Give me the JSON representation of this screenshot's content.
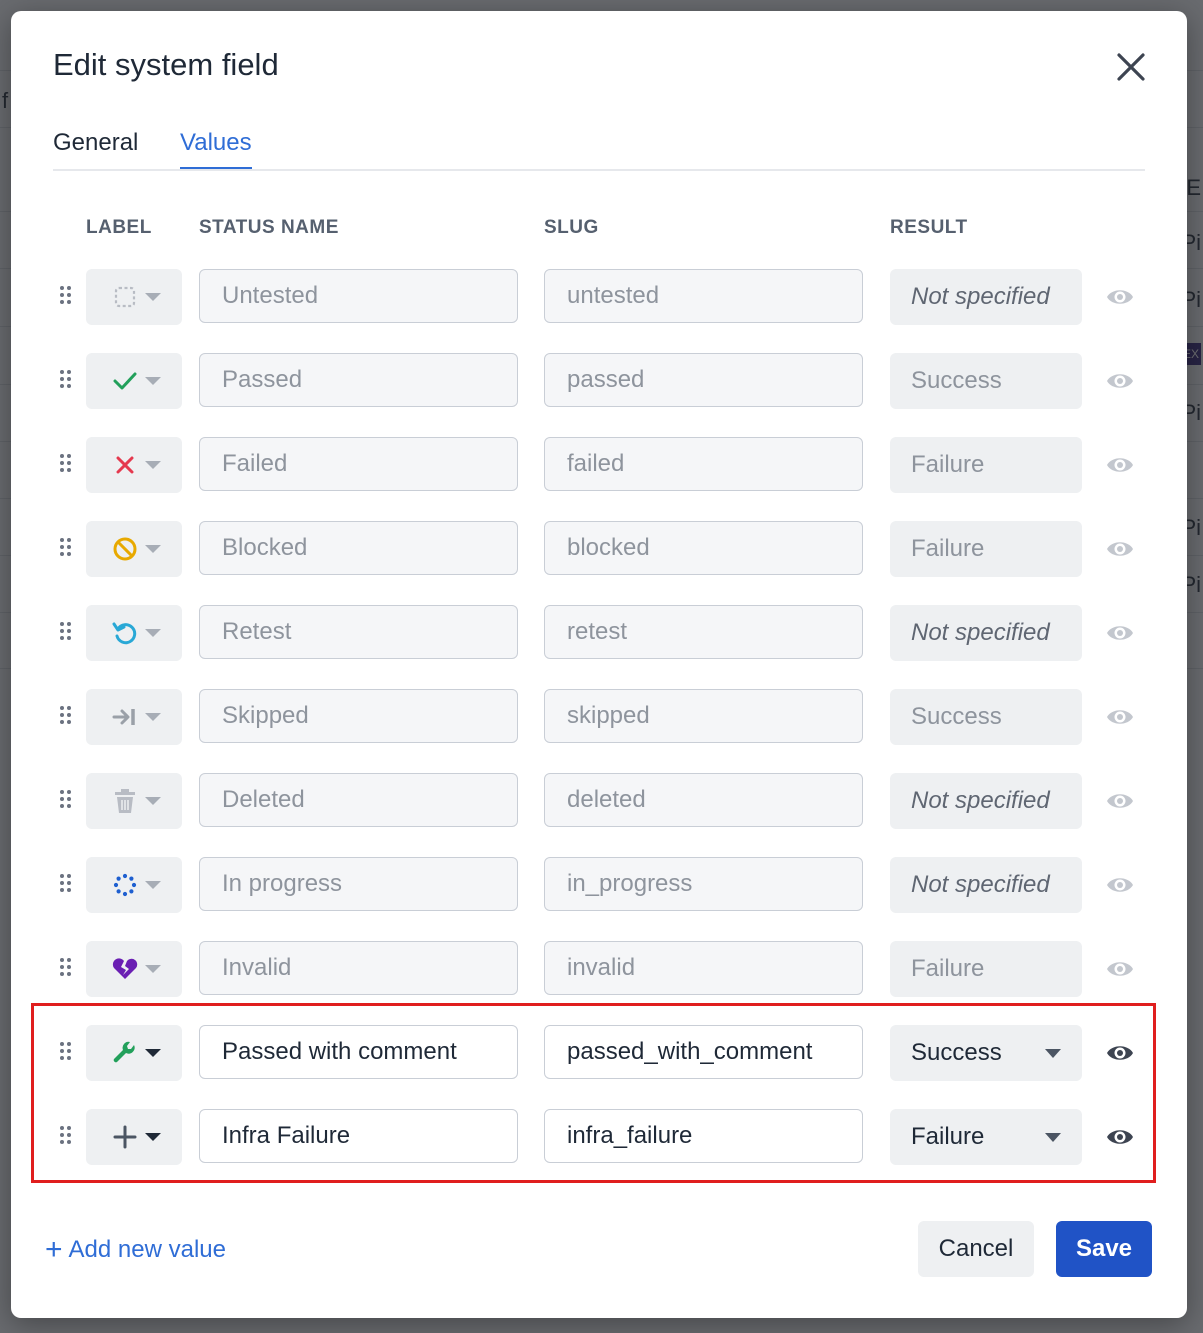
{
  "backdrop": {
    "fragments": [
      "f",
      "UE",
      "Pi",
      "Pi",
      "EX",
      "Pi",
      "Pi",
      "Pi"
    ]
  },
  "dialog": {
    "title": "Edit system field",
    "close_icon": "close-icon",
    "tabs": [
      {
        "label": "General",
        "active": false
      },
      {
        "label": "Values",
        "active": true
      }
    ]
  },
  "columns": {
    "label": "LABEL",
    "status_name": "STATUS NAME",
    "slug": "SLUG",
    "result": "RESULT"
  },
  "rows": [
    {
      "icon": "untested-dashed-square-icon",
      "icon_color": "#b8bcc4",
      "status_name": "Untested",
      "slug": "untested",
      "result": "Not specified",
      "editable": false
    },
    {
      "icon": "check-icon",
      "icon_color": "#22a05b",
      "status_name": "Passed",
      "slug": "passed",
      "result": "Success",
      "editable": false
    },
    {
      "icon": "x-icon",
      "icon_color": "#e5394f",
      "status_name": "Failed",
      "slug": "failed",
      "result": "Failure",
      "editable": false
    },
    {
      "icon": "blocked-circle-icon",
      "icon_color": "#e8a900",
      "status_name": "Blocked",
      "slug": "blocked",
      "result": "Failure",
      "editable": false
    },
    {
      "icon": "retest-arrow-icon",
      "icon_color": "#29a8d6",
      "status_name": "Retest",
      "slug": "retest",
      "result": "Not specified",
      "editable": false
    },
    {
      "icon": "skip-arrow-icon",
      "icon_color": "#9aa0a8",
      "status_name": "Skipped",
      "slug": "skipped",
      "result": "Success",
      "editable": false
    },
    {
      "icon": "trash-icon",
      "icon_color": "#b8bcc4",
      "status_name": "Deleted",
      "slug": "deleted",
      "result": "Not specified",
      "editable": false
    },
    {
      "icon": "spinner-dots-icon",
      "icon_color": "#1e5fd0",
      "status_name": "In progress",
      "slug": "in_progress",
      "result": "Not specified",
      "editable": false
    },
    {
      "icon": "broken-heart-icon",
      "icon_color": "#6a1fb3",
      "status_name": "Invalid",
      "slug": "invalid",
      "result": "Failure",
      "editable": false
    },
    {
      "icon": "wrench-icon",
      "icon_color": "#22a05b",
      "status_name": "Passed with comment",
      "slug": "passed_with_comment",
      "result": "Success",
      "editable": true
    },
    {
      "icon": "plus-icon",
      "icon_color": "#4b5563",
      "status_name": "Infra Failure",
      "slug": "infra_failure",
      "result": "Failure",
      "editable": true
    }
  ],
  "footer": {
    "add_new": "Add new value",
    "cancel": "Cancel",
    "save": "Save"
  }
}
